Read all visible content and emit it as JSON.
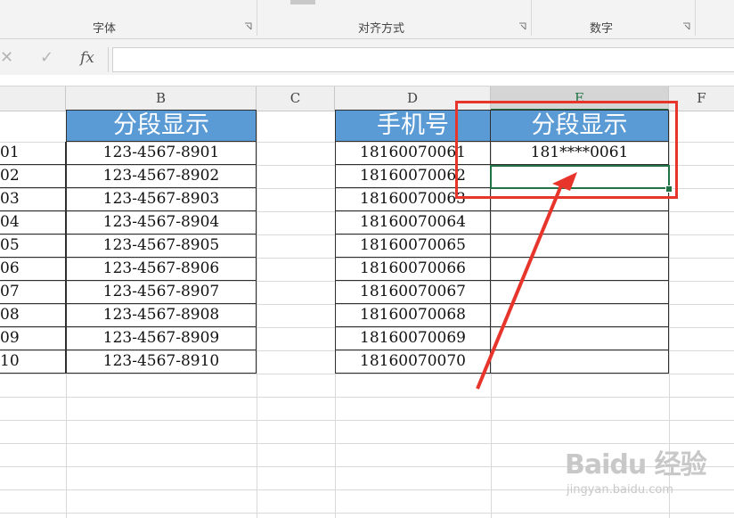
{
  "ribbon": {
    "groups": [
      {
        "label": "字体"
      },
      {
        "label": "对齐方式"
      },
      {
        "label": "数字"
      }
    ]
  },
  "formula_bar": {
    "cancel_icon": "✕",
    "enter_icon": "✓",
    "function_label": "fx",
    "formula_value": ""
  },
  "columns": [
    {
      "label": "B"
    },
    {
      "label": "C"
    },
    {
      "label": "D"
    },
    {
      "label": "E",
      "selected": true
    },
    {
      "label": "F"
    }
  ],
  "table_left": {
    "header": "分段显示",
    "col_a_partial": [
      "01",
      "02",
      "03",
      "04",
      "05",
      "06",
      "07",
      "08",
      "09",
      "10"
    ],
    "values": [
      "123-4567-8901",
      "123-4567-8902",
      "123-4567-8903",
      "123-4567-8904",
      "123-4567-8905",
      "123-4567-8906",
      "123-4567-8907",
      "123-4567-8908",
      "123-4567-8909",
      "123-4567-8910"
    ]
  },
  "table_right": {
    "header_phone": "手机号",
    "header_display": "分段显示",
    "phones": [
      "18160070061",
      "18160070062",
      "18160070063",
      "18160070064",
      "18160070065",
      "18160070066",
      "18160070067",
      "18160070068",
      "18160070069",
      "18160070070"
    ],
    "display": [
      "181****0061",
      "",
      "",
      "",
      "",
      "",
      "",
      "",
      "",
      ""
    ]
  },
  "annotation": {
    "box_color": "#e8352c",
    "arrow_color": "#e8352c"
  },
  "selection_color": "#217346",
  "header_fill": "#5b9bd5",
  "watermark": {
    "main": "Baidu 经验",
    "sub": "jingyan.baidu.com"
  }
}
